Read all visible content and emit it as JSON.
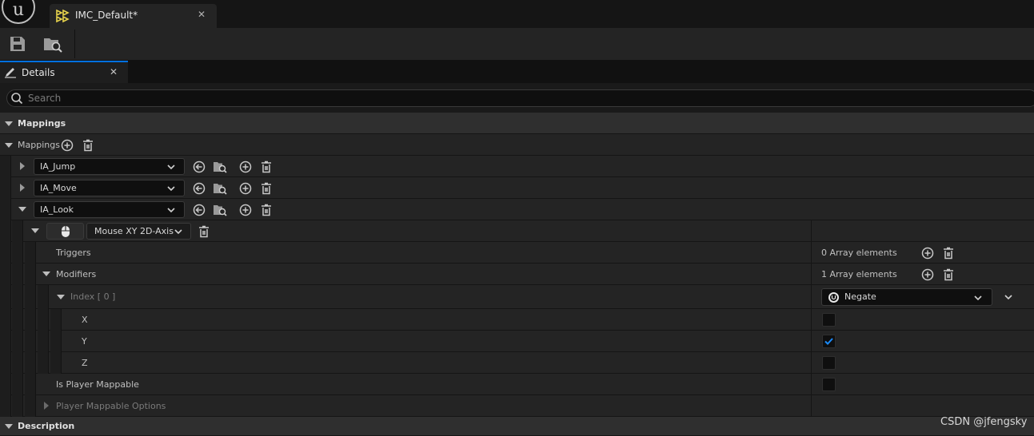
{
  "window": {
    "logo_icon": "unreal-engine-logo-icon",
    "logo_glyph": "u",
    "tab_title": "IMC_Default*",
    "tab_icon": "input-mapping-context-icon",
    "tab_close": "✕"
  },
  "toolbar": {
    "buttons": [
      {
        "icon": "save-icon"
      },
      {
        "icon": "browse-to-asset-icon"
      }
    ]
  },
  "details_tab": {
    "label": "Details",
    "icon": "pencil-icon",
    "close": "✕"
  },
  "search": {
    "placeholder": "Search",
    "value": ""
  },
  "mappings_category": "Mappings",
  "mappings_array_label": "Mappings",
  "actions": [
    {
      "name": "IA_Jump",
      "expanded": false
    },
    {
      "name": "IA_Move",
      "expanded": false
    },
    {
      "name": "IA_Look",
      "expanded": true
    }
  ],
  "key_mapping": {
    "key_icon": "mouse-icon",
    "key": "Mouse XY 2D-Axis",
    "triggers_label": "Triggers",
    "triggers_value": "0 Array elements",
    "modifiers_label": "Modifiers",
    "modifiers_value": "1 Array elements",
    "index_label": "Index [ 0 ]",
    "modifier_icon": "unreal-class-icon",
    "modifier_value": "Negate",
    "axes": [
      {
        "label": "X",
        "checked": false
      },
      {
        "label": "Y",
        "checked": true
      },
      {
        "label": "Z",
        "checked": false
      }
    ],
    "player_mappable_label": "Is Player Mappable",
    "player_mappable_checked": false,
    "player_mappable_options_label": "Player Mappable Options"
  },
  "description_category": "Description",
  "watermark": "CSDN @jfengsky",
  "colors": {
    "accent": "#0070e0",
    "check": "#1a8cff"
  }
}
